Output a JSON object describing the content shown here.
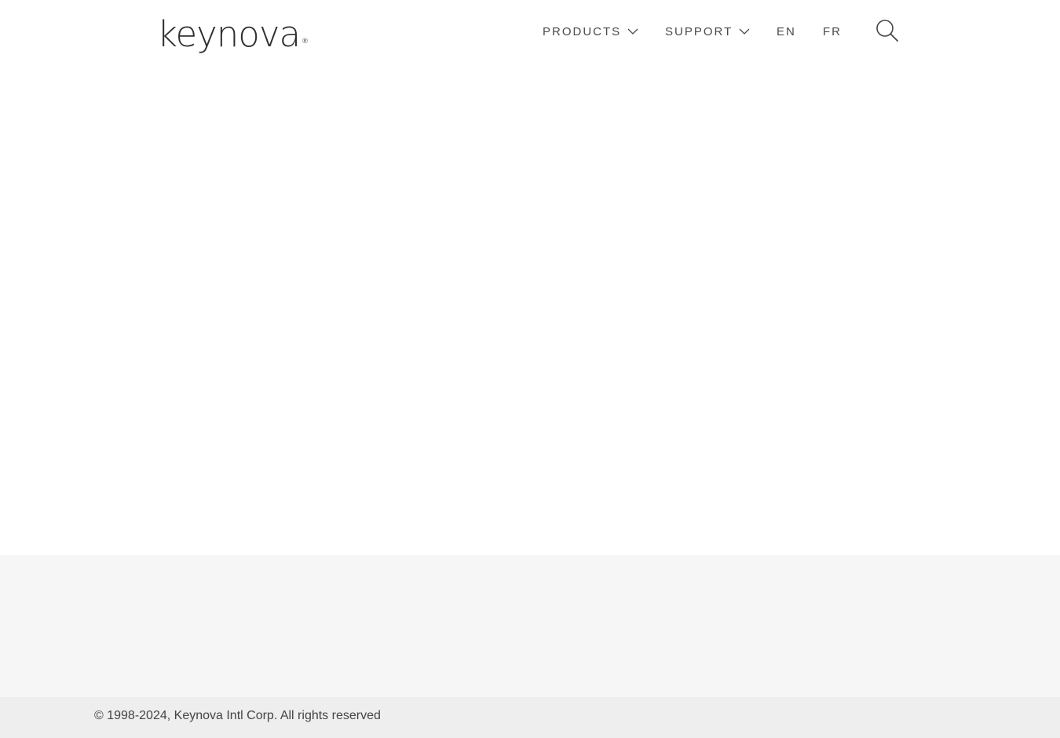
{
  "brand": {
    "logo_text": "keynova",
    "logo_mark": "®"
  },
  "nav": {
    "products_label": "PRODUCTS",
    "support_label": "SUPPORT",
    "lang_en": "EN",
    "lang_fr": "FR"
  },
  "icons": {
    "search": "search-icon",
    "products_dropdown": "chevron-down-icon",
    "support_dropdown": "chevron-down-icon"
  },
  "footer": {
    "copyright": "© 1998-2024, Keynova Intl Corp. All rights reserved"
  },
  "colors": {
    "text": "#4a4a4a",
    "footer_band": "#f6f6f6",
    "footer_bottom": "#eeeeee"
  }
}
